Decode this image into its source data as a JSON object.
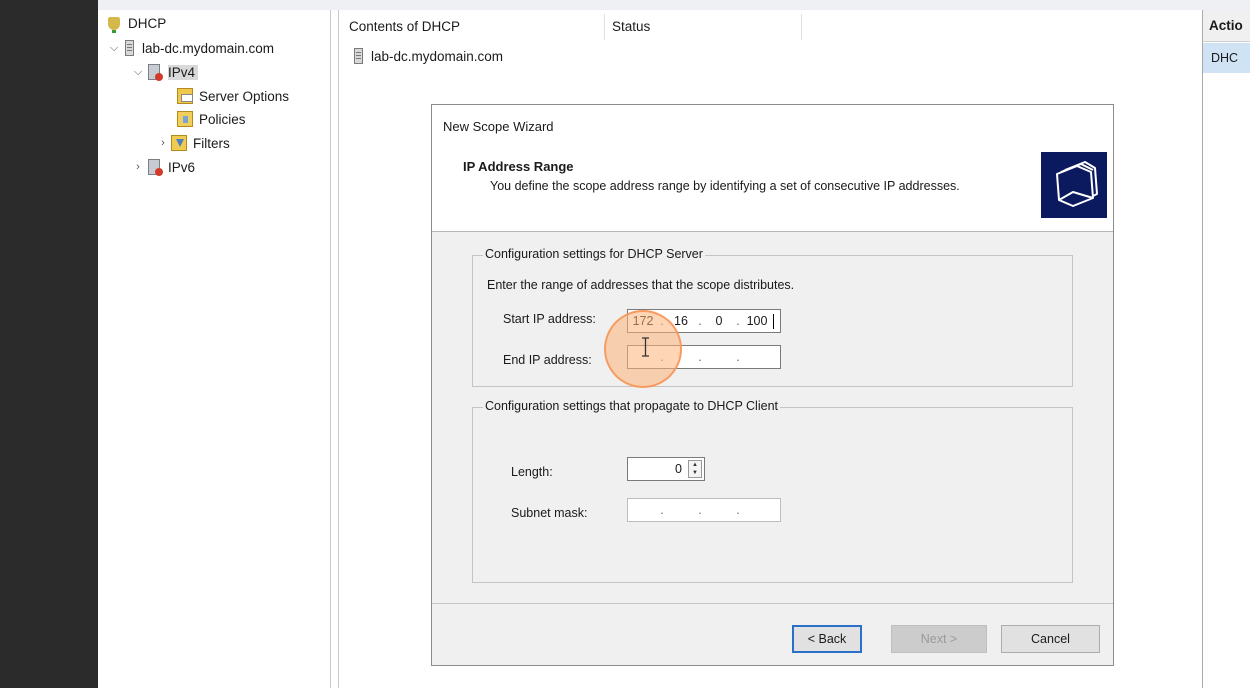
{
  "tree": {
    "root": "DHCP",
    "server": "lab-dc.mydomain.com",
    "ipv4": "IPv4",
    "server_options": "Server Options",
    "policies": "Policies",
    "filters": "Filters",
    "ipv6": "IPv6"
  },
  "contents": {
    "column_name": "Contents of DHCP",
    "column_status": "Status",
    "row_server": "lab-dc.mydomain.com"
  },
  "actions": {
    "header": "Actio",
    "item": "DHC"
  },
  "wizard": {
    "title": "New Scope Wizard",
    "heading": "IP Address Range",
    "description": "You define the scope address range by identifying a set of consecutive IP addresses.",
    "server_group_label": "Configuration settings for DHCP Server",
    "instruction": "Enter the range of addresses that the scope distributes.",
    "start_ip_label": "Start IP address:",
    "start_ip": [
      "172",
      "16",
      "0",
      "100"
    ],
    "end_ip_label": "End IP address:",
    "end_ip": [
      "",
      "",
      "",
      ""
    ],
    "client_group_label": "Configuration settings that propagate to DHCP Client",
    "length_label": "Length:",
    "length_value": "0",
    "subnet_label": "Subnet mask:",
    "subnet_mask": [
      "",
      "",
      "",
      ""
    ],
    "back_label": "< Back",
    "next_label": "Next >",
    "cancel_label": "Cancel"
  },
  "icons": {
    "wizard_graphic": "folders-icon",
    "cursor": "text-cursor-icon"
  },
  "colors": {
    "wizard_graphic_bg": "#0b1a5e",
    "selection": "#cfe3f5",
    "default_button_border": "#2a70c8",
    "cursor_highlight": "#f5965a"
  }
}
